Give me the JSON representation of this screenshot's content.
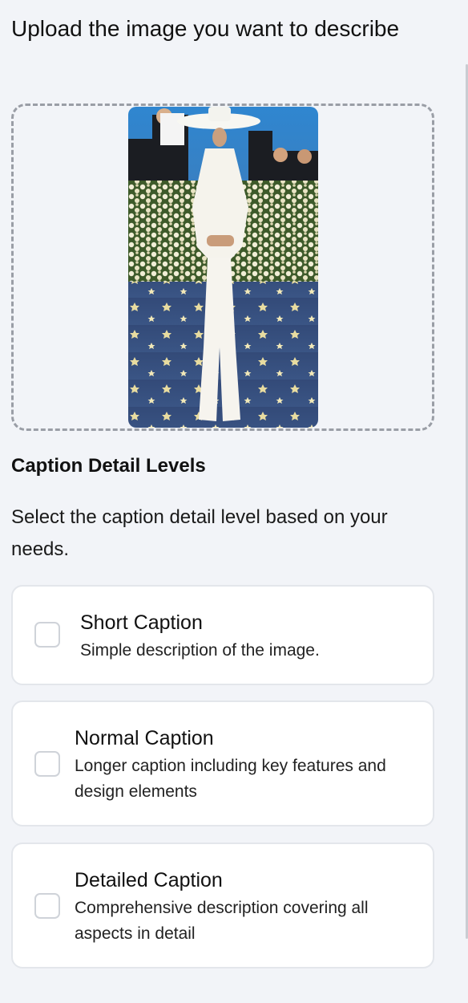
{
  "upload": {
    "title": "Upload the image you want to describe"
  },
  "caption_section": {
    "heading": "Caption Detail Levels",
    "description": "Select the caption detail level based on your needs."
  },
  "options": [
    {
      "title": "Short Caption",
      "description": "Simple description of the image.",
      "checked": false
    },
    {
      "title": "Normal Caption",
      "description": "Longer caption including key features and design elements",
      "checked": false
    },
    {
      "title": "Detailed Caption",
      "description": "Comprehensive description covering all aspects in detail",
      "checked": false
    }
  ],
  "colors": {
    "background": "#f2f4f8",
    "card": "#ffffff",
    "border": "#e3e6eb",
    "dashed_border": "#9a9ea6"
  }
}
